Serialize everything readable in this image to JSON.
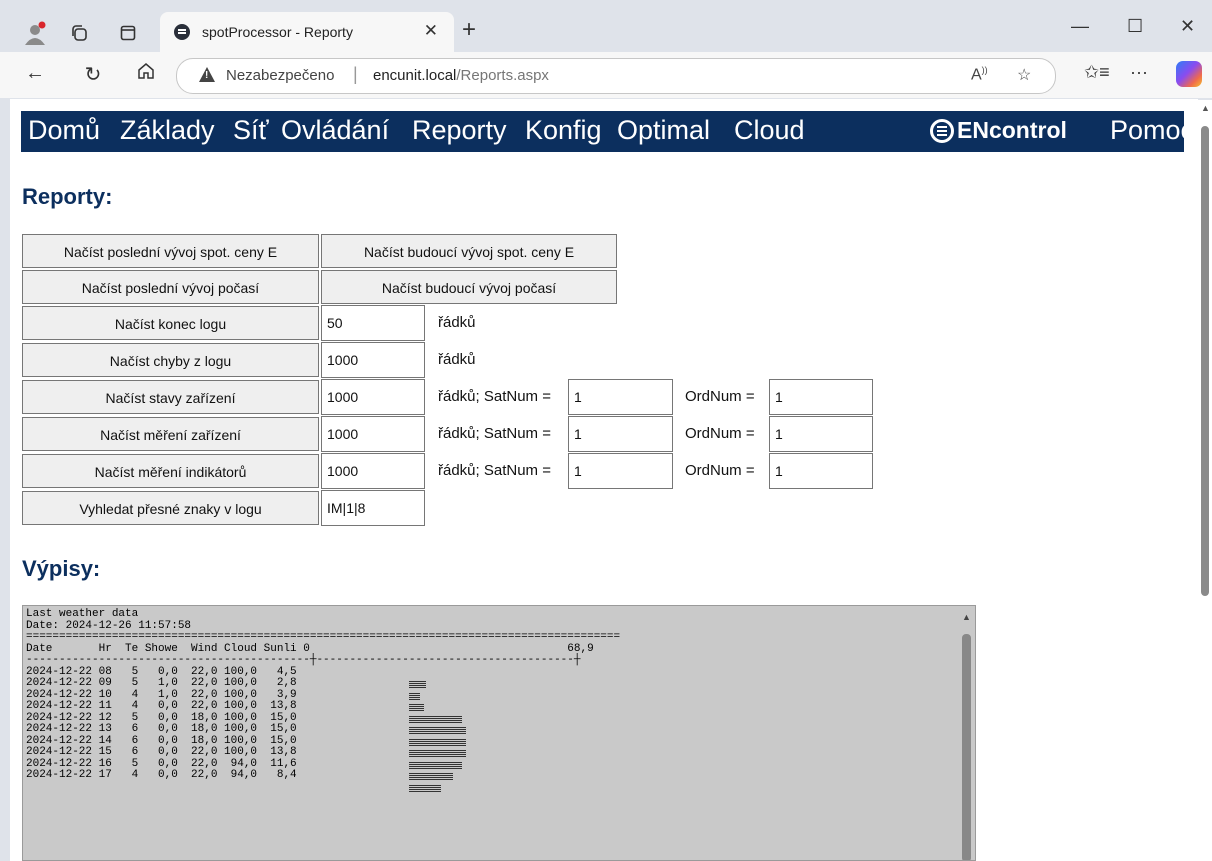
{
  "browser": {
    "tab_title": "spotProcessor - Reporty",
    "insecure_label": "Nezabezpečeno",
    "url_host": "encunit.local",
    "url_path": "/Reports.aspx"
  },
  "nav": {
    "items": [
      "Domů",
      "Základy",
      "Síť",
      "Ovládání",
      "Reporty",
      "Konfig",
      "Optimal",
      "Cloud"
    ],
    "logo": "ENcontrol",
    "help": "Pomoc"
  },
  "reports": {
    "heading": "Reporty:",
    "btn_last_spot": "Načíst poslední vývoj spot. ceny E",
    "btn_future_spot": "Načíst budoucí vývoj spot. ceny E",
    "btn_last_weather": "Načíst poslední vývoj počasí",
    "btn_future_weather": "Načíst budoucí vývoj počasí",
    "rows": [
      {
        "button": "Načíst konec logu",
        "value": "50",
        "label": "řádků"
      },
      {
        "button": "Načíst chyby z logu",
        "value": "1000",
        "label": "řádků"
      },
      {
        "button": "Načíst stavy zařízení",
        "value": "1000",
        "label": "řádků; SatNum =",
        "satnum": "1",
        "ordlabel": "OrdNum =",
        "ordnum": "1"
      },
      {
        "button": "Načíst měření zařízení",
        "value": "1000",
        "label": "řádků; SatNum =",
        "satnum": "1",
        "ordlabel": "OrdNum =",
        "ordnum": "1"
      },
      {
        "button": "Načíst měření indikátorů",
        "value": "1000",
        "label": "řádků; SatNum =",
        "satnum": "1",
        "ordlabel": "OrdNum =",
        "ordnum": "1"
      },
      {
        "button": "Vyhledat přesné znaky v logu",
        "value": "IM|1|8"
      }
    ]
  },
  "output": {
    "heading": "Výpisy:",
    "lines": [
      "Last weather data",
      "Date: 2024-12-26 11:57:58",
      "==========================================================================================",
      "Date       Hr  Te Showe  Wind Cloud Sunli 0                                       68,9",
      "-------------------------------------------┼---------------------------------------┼",
      "",
      "2024-12-22 08   5   0,0  22,0 100,0   4,5",
      "2024-12-22 09   5   1,0  22,0 100,0   2,8",
      "2024-12-22 10   4   1,0  22,0 100,0   3,9",
      "2024-12-22 11   4   0,0  22,0 100,0  13,8",
      "2024-12-22 12   5   0,0  18,0 100,0  15,0",
      "2024-12-22 13   6   0,0  18,0 100,0  15,0",
      "2024-12-22 14   6   0,0  18,0 100,0  15,0",
      "2024-12-22 15   6   0,0  22,0 100,0  13,8",
      "2024-12-22 16   5   0,0  22,0  94,0  11,6",
      "2024-12-22 17   4   0,0  22,0  94,0   8,4"
    ],
    "sunlight_max": 68.9,
    "sunlight_values": [
      4.5,
      2.8,
      3.9,
      13.8,
      15.0,
      15.0,
      15.0,
      13.8,
      11.6,
      8.4
    ]
  }
}
